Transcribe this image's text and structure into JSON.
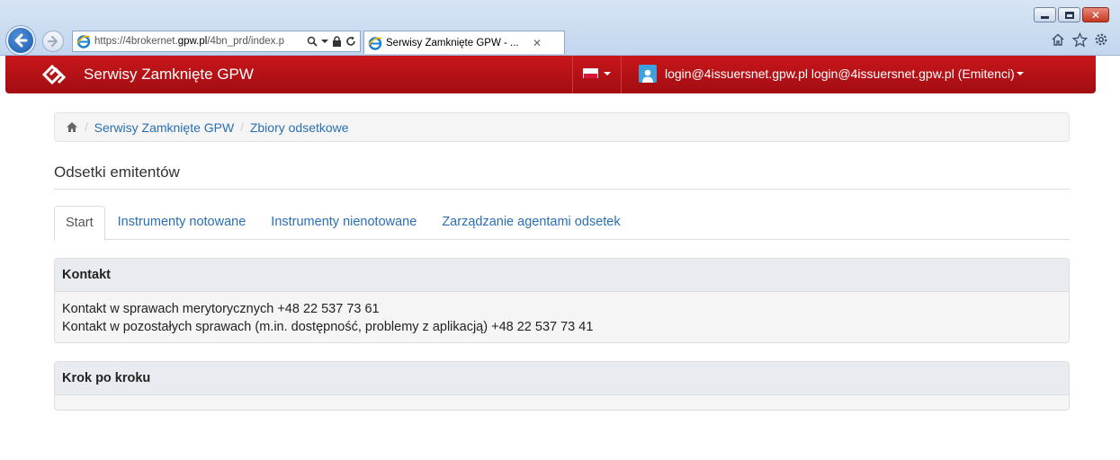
{
  "browser": {
    "url_prefix": "https://4brokernet.",
    "url_domain": "gpw.pl",
    "url_path": "/4bn_prd/index.p",
    "tab_title": "Serwisy Zamknięte GPW - ...",
    "tab_close": "✕",
    "window_buttons": [
      "minimize-icon",
      "maximize-icon",
      "close-icon"
    ]
  },
  "navbar": {
    "brand": "Serwisy Zamknięte GPW",
    "language": "pl",
    "user_label": "login@4issuersnet.gpw.pl login@4issuersnet.gpw.pl (Emitenci)"
  },
  "breadcrumb": {
    "items": [
      "Serwisy Zamknięte GPW",
      "Zbiory odsetkowe"
    ]
  },
  "page": {
    "title": "Odsetki emitentów"
  },
  "tabs": [
    {
      "label": "Start",
      "active": true
    },
    {
      "label": "Instrumenty notowane",
      "active": false
    },
    {
      "label": "Instrumenty nienotowane",
      "active": false
    },
    {
      "label": "Zarządzanie agentami odsetek",
      "active": false
    }
  ],
  "panels": {
    "kontakt": {
      "heading": "Kontakt",
      "lines": [
        "Kontakt w sprawach merytorycznych +48 22 537 73 61",
        "Kontakt w pozostałych sprawach (m.in. dostępność, problemy z aplikacją) +48 22 537 73 41"
      ]
    },
    "krok": {
      "heading": "Krok po kroku"
    }
  },
  "colors": {
    "navbar": "#b5111a",
    "link": "#2a6fb5",
    "panel_heading_bg": "#e8ecf0"
  }
}
